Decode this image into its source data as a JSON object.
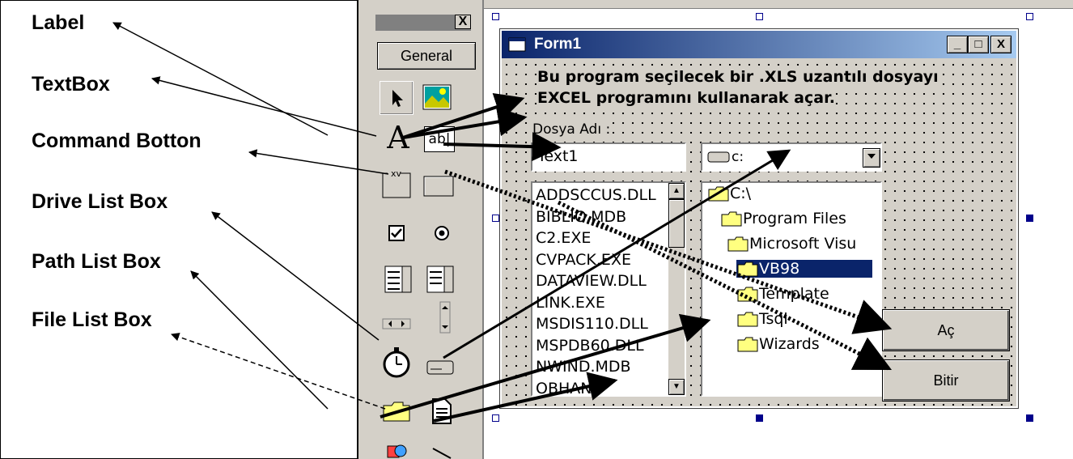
{
  "captions": {
    "label": "Label",
    "textbox": "TextBox",
    "command_button": "Command Botton",
    "drive_list_box": "Drive List Box",
    "path_list_box": "Path List Box",
    "file_list_box": "File List Box"
  },
  "toolbox": {
    "close_label": "X",
    "tab_label": "General",
    "label_tool_glyph": "A",
    "textbox_tool_glyph": "ab|",
    "frame_tool_glyph": "xv"
  },
  "form": {
    "title": "Form1",
    "minimize": "_",
    "maximize": "□",
    "close": "X",
    "description_line1": "Bu program seçilecek bir .XLS uzantılı dosyayı",
    "description_line2": "EXCEL programını kullanarak açar.",
    "file_name_label": "Dosya Adı :",
    "file_name_value": "Text1",
    "drive_value": "c:",
    "files": [
      "ADDSCCUS.DLL",
      "BIBLIO.MDB",
      "C2.EXE",
      "CVPACK.EXE",
      "DATAVIEW.DLL",
      "LINK.EXE",
      "MSDIS110.DLL",
      "MSPDB60.DLL",
      "NWIND.MDB",
      "OBHAN"
    ],
    "dirs": [
      "C:\\",
      "Program Files",
      "Microsoft Visu",
      "VB98",
      "Template",
      "Tsql",
      "Wizards"
    ],
    "selected_dir": "VB98",
    "open_button": "Aç",
    "exit_button": "Bitir"
  },
  "colors": {
    "titlebar": "#0a246a",
    "titlebar_end": "#a6caf0",
    "face": "#d4d0c8",
    "selection": "#0a246a"
  }
}
